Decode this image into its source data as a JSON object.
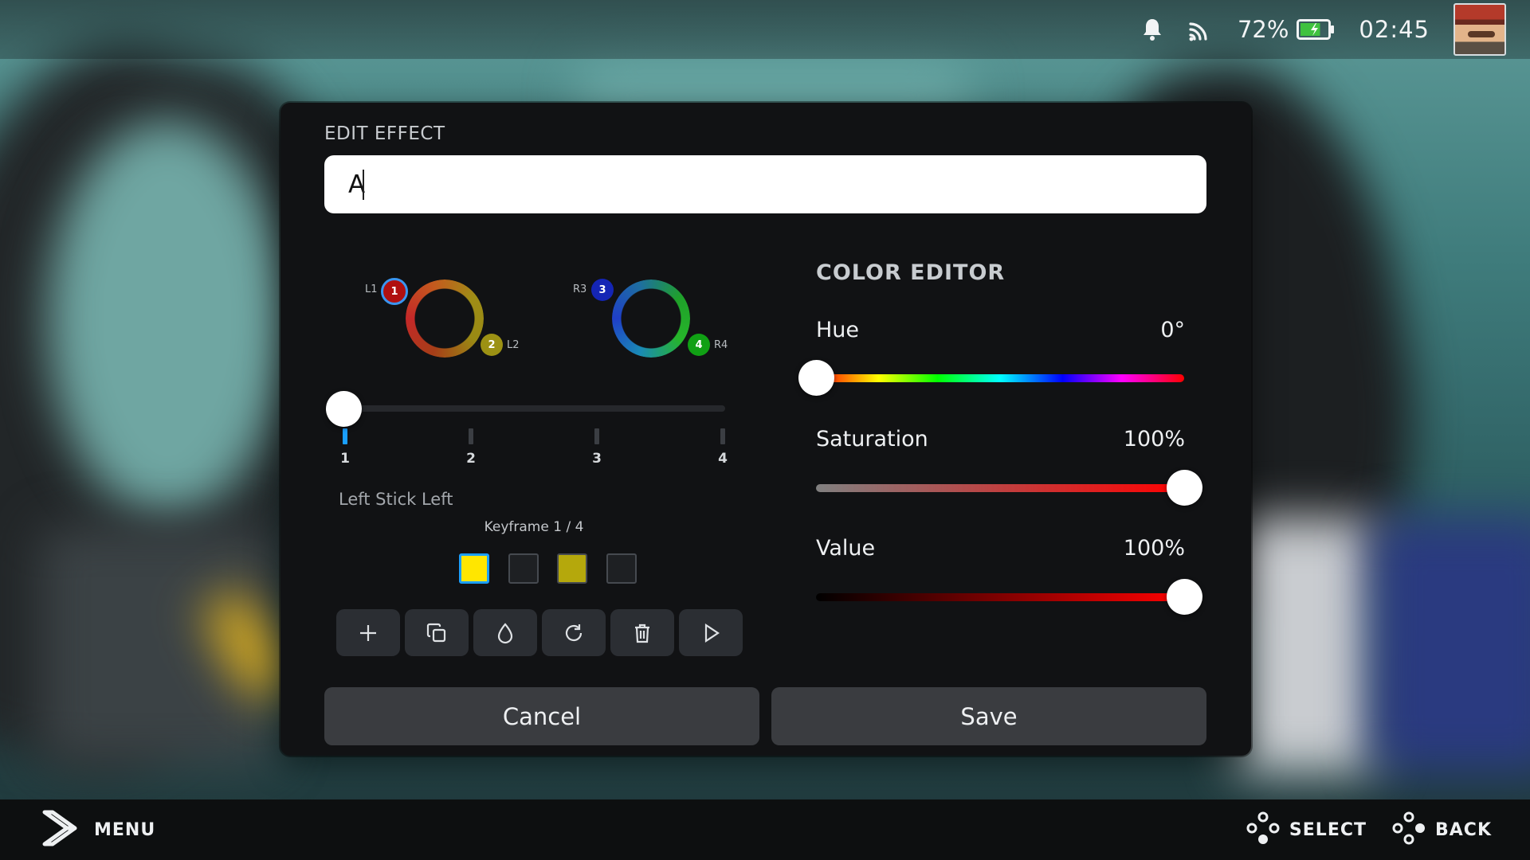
{
  "status_bar": {
    "battery_percent": "72%",
    "battery_level": 0.72,
    "time": "02:45",
    "icons": [
      "bell-icon",
      "cast-icon",
      "battery-charging-icon"
    ]
  },
  "dialog": {
    "title": "EDIT EFFECT",
    "name_value": "A",
    "ring_labels": {
      "n1": "1",
      "n2": "2",
      "n3": "3",
      "n4": "4",
      "l1": "L1",
      "l2": "L2",
      "r3": "R3",
      "r4": "R4"
    },
    "keyframe_ticks": [
      "1",
      "2",
      "3",
      "4"
    ],
    "selected_keyframe": 1,
    "input_name": "Left Stick Left",
    "keyframe_counter": "Keyframe 1 / 4",
    "swatch_colors": [
      "#ffe600",
      "#1e2023",
      "#b5a80c",
      "#1e2023"
    ],
    "tools": [
      "plus-icon",
      "copy-icon",
      "droplet-icon",
      "refresh-icon",
      "trash-icon",
      "play-icon"
    ],
    "color_editor": {
      "title": "COLOR EDITOR",
      "hue": {
        "label": "Hue",
        "value": "0°",
        "fraction": 0.0
      },
      "saturation": {
        "label": "Saturation",
        "value": "100%",
        "fraction": 1.0
      },
      "brightness": {
        "label": "Value",
        "value": "100%",
        "fraction": 1.0
      }
    },
    "cancel_label": "Cancel",
    "save_label": "Save"
  },
  "bottom_bar": {
    "menu_label": "MENU",
    "select_label": "SELECT",
    "back_label": "BACK"
  },
  "colors": {
    "accent": "#1a9fff",
    "dialog_bg": "#111214",
    "button_bg": "#3a3c40"
  }
}
